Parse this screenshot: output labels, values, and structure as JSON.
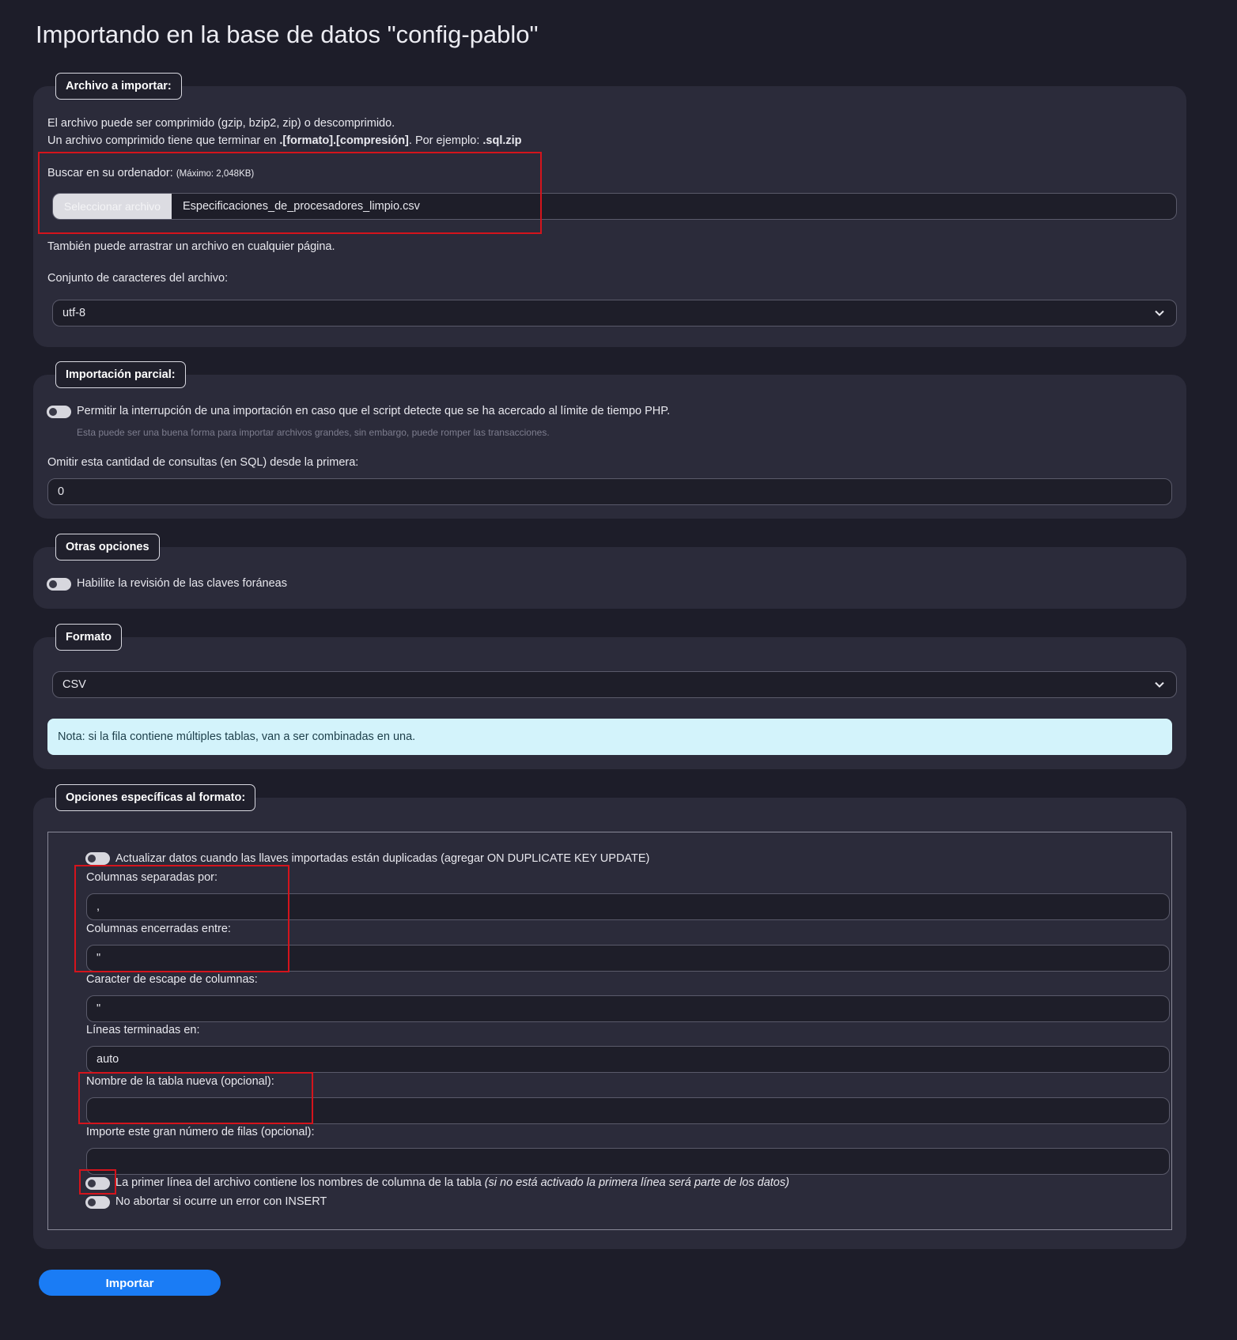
{
  "page": {
    "title": "Importando en la base de datos \"config-pablo\""
  },
  "file_section": {
    "legend": "Archivo a importar:",
    "line1": "El archivo puede ser comprimido (gzip, bzip2, zip) o descomprimido.",
    "line2_pre": "Un archivo comprimido tiene que terminar en ",
    "line2_bold": ".[formato].[compresión]",
    "line2_mid": ". Por ejemplo: ",
    "line2_example": ".sql.zip",
    "browse_label": "Buscar en su ordenador:",
    "max_size": "(Máximo: 2,048KB)",
    "file_button": "Seleccionar archivo",
    "file_name": "Especificaciones_de_procesadores_limpio.csv",
    "drag_hint": "También puede arrastrar un archivo en cualquier página.",
    "charset_label": "Conjunto de caracteres del archivo:",
    "charset_value": "utf-8"
  },
  "partial_section": {
    "legend": "Importación parcial:",
    "allow_interrupt_label": "Permitir la interrupción de una importación en caso que el script detecte que se ha acercado al límite de tiempo PHP.",
    "allow_interrupt_hint": "Esta puede ser una buena forma para importar archivos grandes, sin embargo, puede romper las transacciones.",
    "skip_label": "Omitir esta cantidad de consultas (en SQL) desde la primera:",
    "skip_value": "0"
  },
  "other_section": {
    "legend": "Otras opciones",
    "foreign_keys_label": "Habilite la revisión de las claves foráneas"
  },
  "format_section": {
    "legend": "Formato",
    "format_value": "CSV",
    "note": "Nota: si la fila contiene múltiples tablas, van a ser combinadas en una."
  },
  "format_options": {
    "legend": "Opciones específicas al formato:",
    "update_duplicates_label": "Actualizar datos cuando las llaves importadas están duplicadas (agregar ON DUPLICATE KEY UPDATE)",
    "sep_label": "Columnas separadas por:",
    "sep_value": ",",
    "enclosed_label": "Columnas encerradas entre:",
    "enclosed_value": "\"",
    "escape_label": "Caracter de escape de columnas:",
    "escape_value": "\"",
    "lines_label": "Líneas terminadas en:",
    "lines_value": "auto",
    "table_name_label": "Nombre de la tabla nueva (opcional):",
    "table_name_value": "",
    "rows_label": "Importe este gran número de filas (opcional):",
    "rows_value": "",
    "first_line_label": "La primer línea del archivo contiene los nombres de columna de la tabla",
    "first_line_hint": "(si no está activado la primera línea será parte de los datos)",
    "no_abort_label": "No abortar si ocurre un error con INSERT"
  },
  "actions": {
    "import_button": "Importar"
  }
}
